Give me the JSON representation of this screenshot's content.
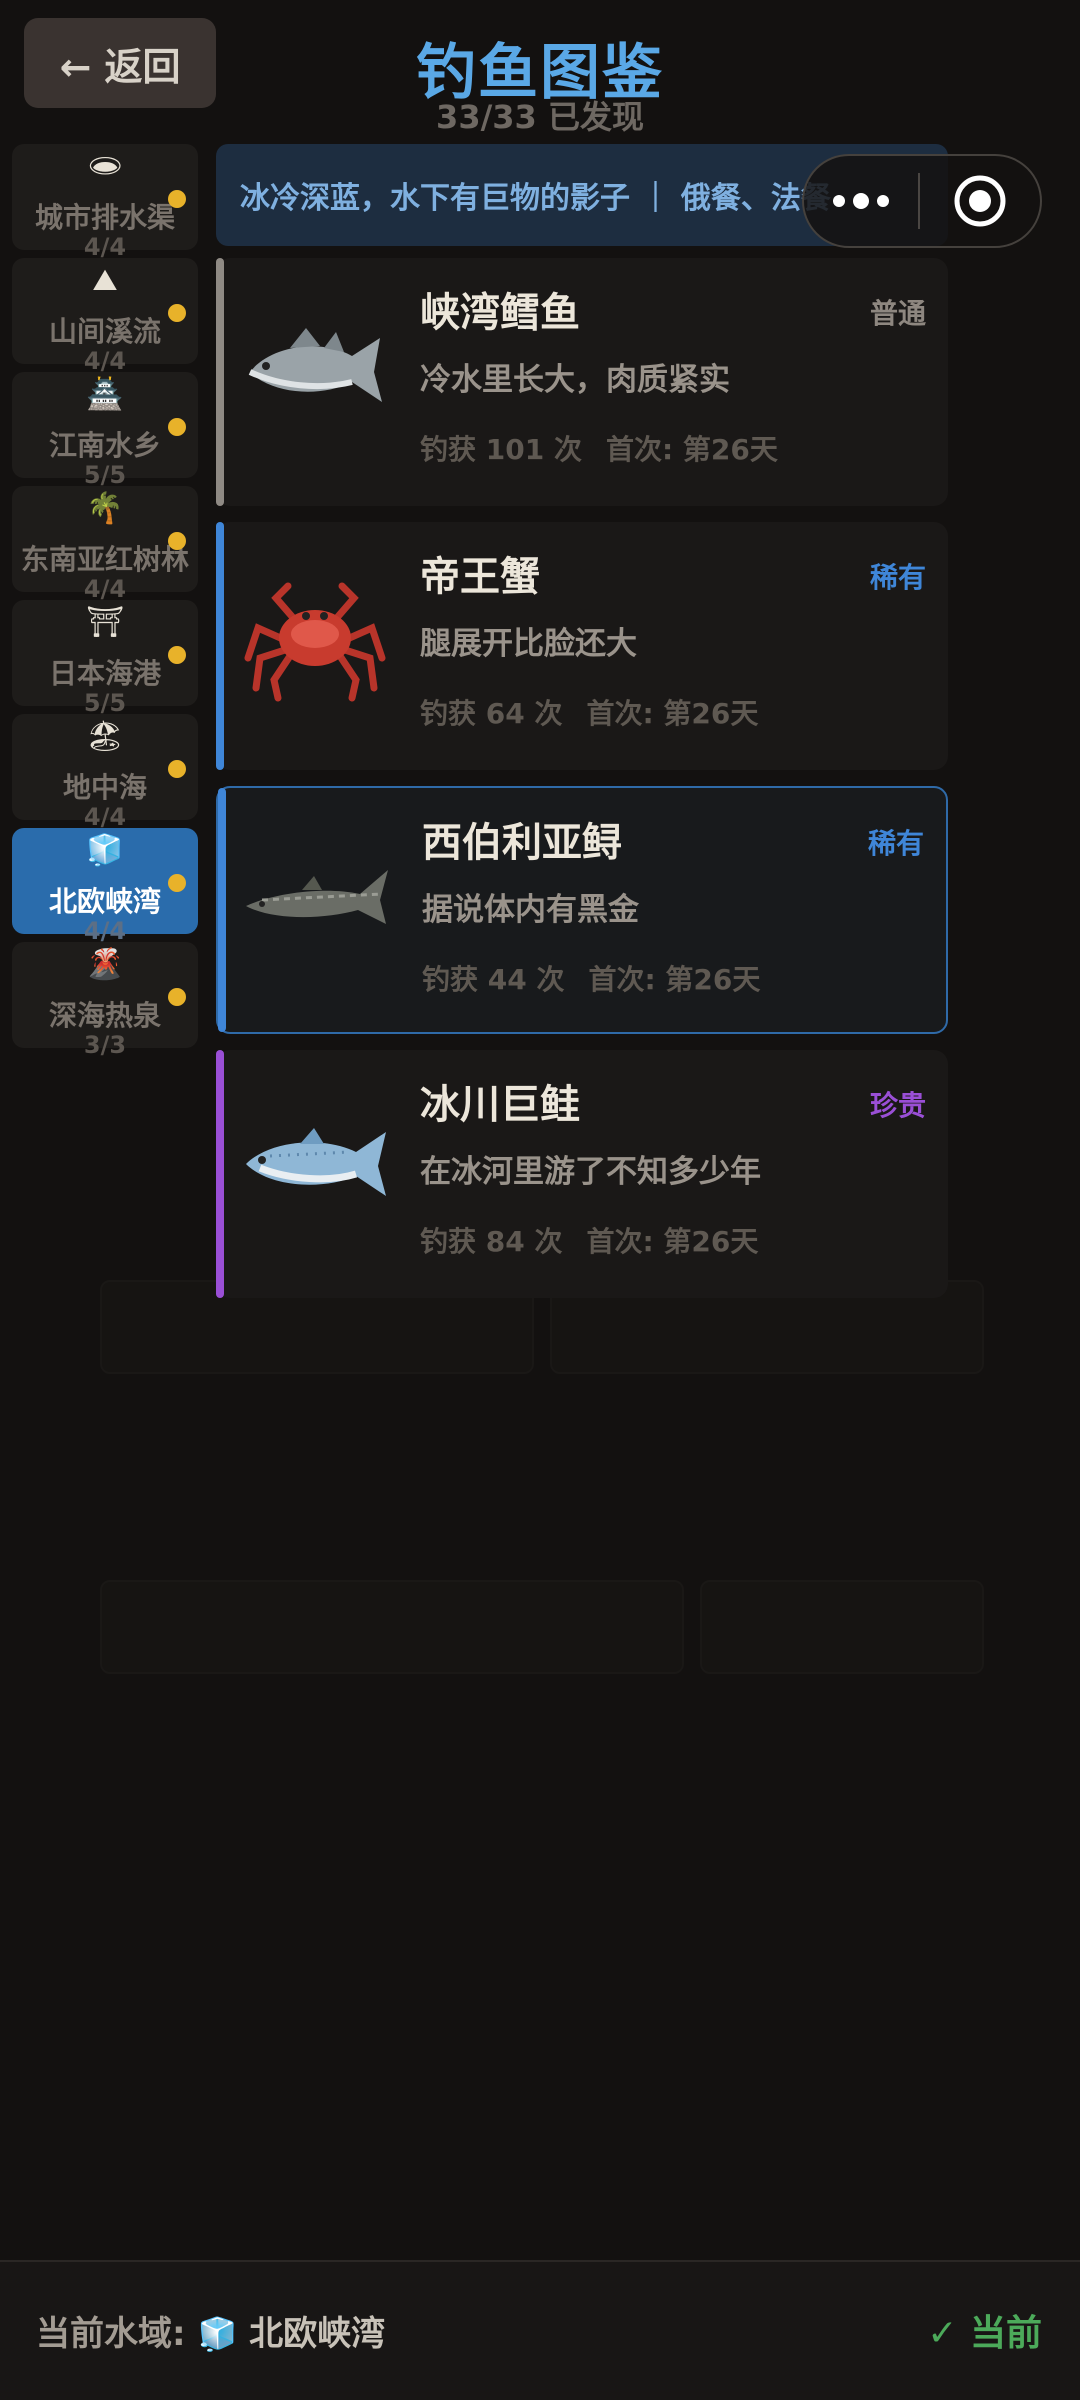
{
  "header": {
    "back_label": "← 返回",
    "title": "钓鱼图鉴",
    "subtitle": "33/33 已发现"
  },
  "banner": {
    "text": "冰冷深蓝，水下有巨物的影子 ｜ 俄餐、法餐"
  },
  "sidebar": {
    "items": [
      {
        "icon": "🕳",
        "icon_name": "manhole-icon",
        "label": "城市排水渠",
        "count": "4/4",
        "active": false
      },
      {
        "icon": "⛰",
        "icon_name": "mountain-icon",
        "label": "山间溪流",
        "count": "4/4",
        "active": false
      },
      {
        "icon": "🏯",
        "icon_name": "pagoda-icon",
        "label": "江南水乡",
        "count": "5/5",
        "active": false
      },
      {
        "icon": "🌴",
        "icon_name": "palm-tree-icon",
        "label": "东南亚红树林",
        "count": "4/4",
        "active": false
      },
      {
        "icon": "⛩",
        "icon_name": "torii-icon",
        "label": "日本海港",
        "count": "5/5",
        "active": false
      },
      {
        "icon": "🏖",
        "icon_name": "beach-umbrella-icon",
        "label": "地中海",
        "count": "4/4",
        "active": false
      },
      {
        "icon": "🧊",
        "icon_name": "ice-cube-icon",
        "label": "北欧峡湾",
        "count": "4/4",
        "active": true
      },
      {
        "icon": "🌋",
        "icon_name": "volcano-icon",
        "label": "深海热泉",
        "count": "3/3",
        "active": false
      }
    ]
  },
  "fish": [
    {
      "name": "峡湾鳕鱼",
      "rarity": "普通",
      "rarity_color": "#8e8780",
      "bar_color": "#8f8a84",
      "desc": "冷水里长大，肉质紧实",
      "caught": "钓获 101 次",
      "first": "首次: 第26天",
      "icon_name": "cod-icon"
    },
    {
      "name": "帝王蟹",
      "rarity": "稀有",
      "rarity_color": "#3f86d8",
      "bar_color": "#3f86d8",
      "desc": "腿展开比脸还大",
      "caught": "钓获 64 次",
      "first": "首次: 第26天",
      "icon_name": "king-crab-icon"
    },
    {
      "name": "西伯利亚鲟",
      "rarity": "稀有",
      "rarity_color": "#3f86d8",
      "bar_color": "#3f86d8",
      "desc": "据说体内有黑金",
      "caught": "钓获 44 次",
      "first": "首次: 第26天",
      "icon_name": "sturgeon-icon"
    },
    {
      "name": "冰川巨鲑",
      "rarity": "珍贵",
      "rarity_color": "#9a4fd6",
      "bar_color": "#9a4fd6",
      "desc": "在冰河里游了不知多少年",
      "caught": "钓获 84 次",
      "first": "首次: 第26天",
      "icon_name": "salmon-icon"
    }
  ],
  "footer": {
    "current_label": "当前水域:",
    "current_icon": "🧊",
    "current_region": "北欧峡湾",
    "status": "✓ 当前"
  }
}
